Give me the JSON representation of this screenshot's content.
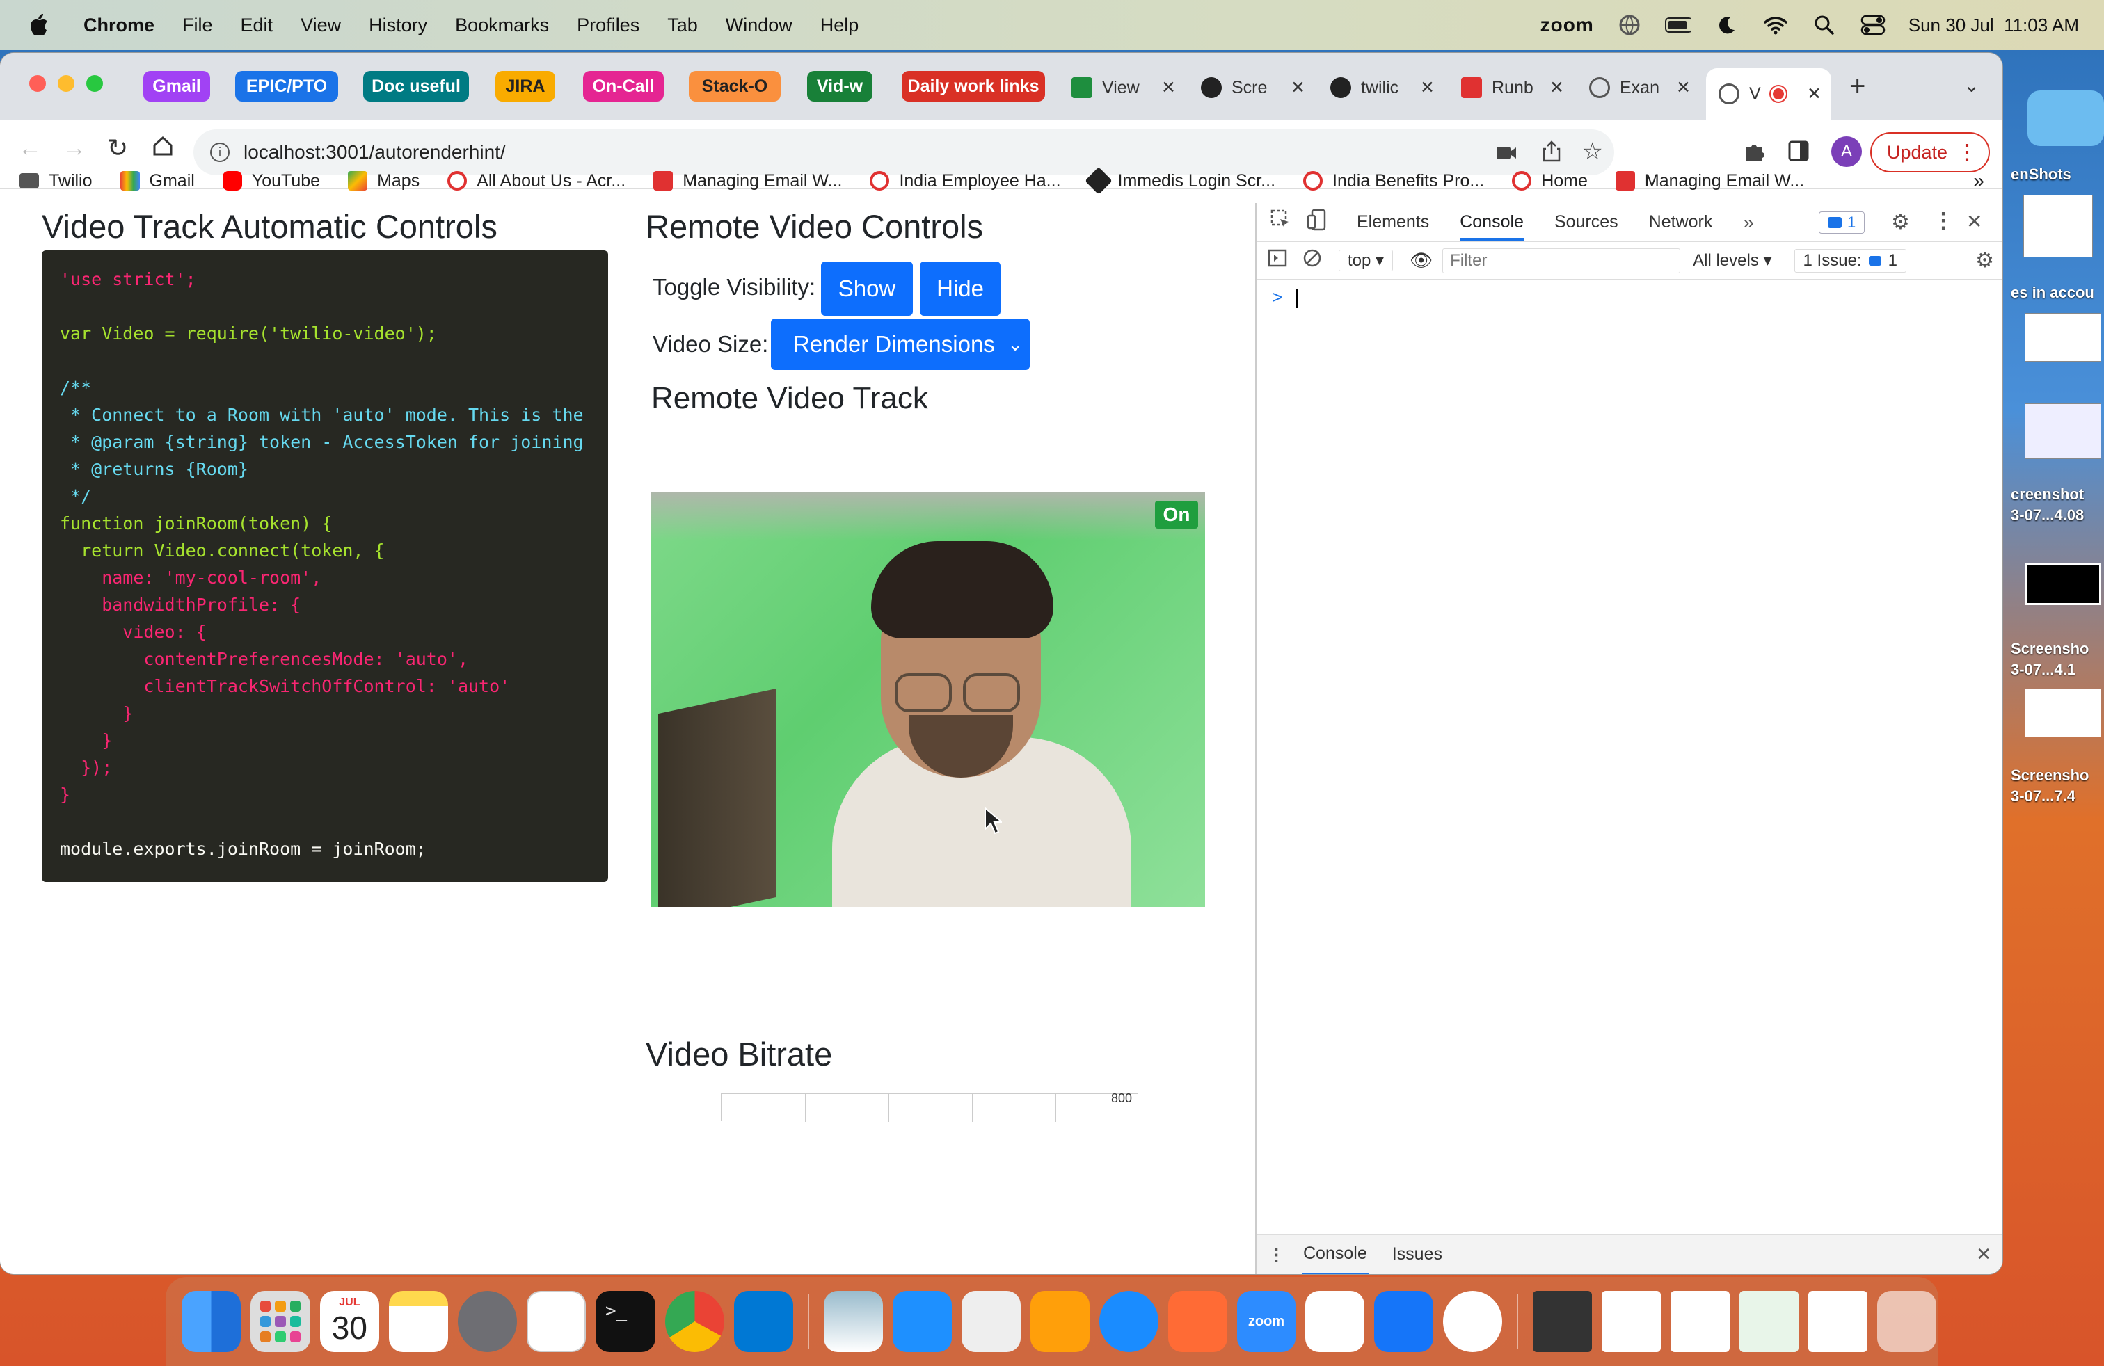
{
  "menubar": {
    "app": "Chrome",
    "items": [
      "File",
      "Edit",
      "View",
      "History",
      "Bookmarks",
      "Profiles",
      "Tab",
      "Window",
      "Help"
    ],
    "zoom": "zoom",
    "datetime": "Sun 30 Jul  11:03 AM"
  },
  "tabs": {
    "groups": [
      {
        "label": "Gmail",
        "color": "#a142f4"
      },
      {
        "label": "EPIC/PTO",
        "color": "#1a73e8"
      },
      {
        "label": "Doc useful",
        "color": "#007b83"
      },
      {
        "label": "JIRA",
        "color": "#f9ab00"
      },
      {
        "label": "On-Call",
        "color": "#e52592"
      },
      {
        "label": "Stack-O",
        "color": "#fa903e"
      },
      {
        "label": "Vid-w",
        "color": "#188038"
      },
      {
        "label": "Daily work links",
        "color": "#d93025"
      }
    ],
    "pages": [
      "View",
      "Scre",
      "twilic",
      "Runb",
      "Exan",
      "V"
    ]
  },
  "toolbar": {
    "url": "localhost:3001/autorenderhint/",
    "profile_initial": "A",
    "update_label": "Update"
  },
  "bookmarks": [
    "Twilio",
    "Gmail",
    "YouTube",
    "Maps",
    "All About Us - Acr...",
    "Managing Email W...",
    "India Employee Ha...",
    "Immedis Login Scr...",
    "India Benefits Pro...",
    "Home",
    "Managing Email W..."
  ],
  "page": {
    "left_title": "Video Track Automatic Controls",
    "right_title": "Remote Video Controls",
    "toggle_label": "Toggle Visibility:",
    "show_label": "Show",
    "hide_label": "Hide",
    "size_label": "Video Size:",
    "size_select": "Render Dimensions",
    "track_title": "Remote Video Track",
    "on_badge": "On",
    "bitrate_title": "Video Bitrate",
    "bitrate_tick": "800"
  },
  "devtools": {
    "tabs": [
      "Elements",
      "Console",
      "Sources",
      "Network"
    ],
    "active_tab": "Console",
    "badge": "1",
    "context": "top",
    "filter_placeholder": "Filter",
    "levels": "All levels",
    "issues": "1 Issue:",
    "issues_count": "1",
    "prompt": ">",
    "drawer_tabs": [
      "Console",
      "Issues"
    ]
  },
  "desktop": {
    "labels": [
      "enShots",
      "es in accou",
      "creenshot",
      "3-07...4.08",
      "Screensho",
      "3-07...4.1",
      "Screensho",
      "3-07...7.4"
    ]
  },
  "dock": {
    "calendar_month": "JUL",
    "calendar_day": "30"
  },
  "code_lines": [
    "'use strict';",
    "",
    "var Video = require('twilio-video');",
    "",
    "/**",
    " * Connect to a Room with 'auto' mode. This is the",
    " * @param {string} token - AccessToken for joining",
    " * @returns {Room}",
    " */",
    "function joinRoom(token) {",
    "  return Video.connect(token, {",
    "    name: 'my-cool-room',",
    "    bandwidthProfile: {",
    "      video: {",
    "        contentPreferencesMode: 'auto',",
    "        clientTrackSwitchOffControl: 'auto'",
    "      }",
    "    }",
    "  });",
    "}",
    "",
    "module.exports.joinRoom = joinRoom;"
  ]
}
